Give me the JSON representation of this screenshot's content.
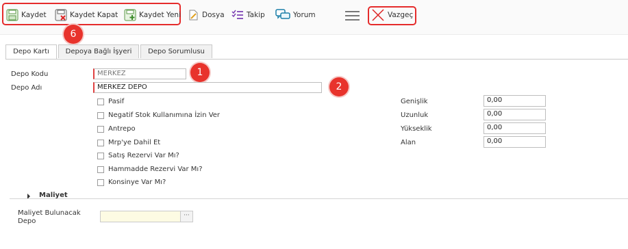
{
  "toolbar": {
    "kaydet": "Kaydet",
    "kaydet_kapat": "Kaydet Kapat",
    "kaydet_yeni": "Kaydet Yeni",
    "dosya": "Dosya",
    "takip": "Takip",
    "yorum": "Yorum",
    "vazgec": "Vazgeç"
  },
  "badges": {
    "b1": "1",
    "b2": "2",
    "b6": "6"
  },
  "tabs": [
    {
      "label": "Depo Kartı",
      "active": true
    },
    {
      "label": "Depoya Bağlı İşyeri",
      "active": false
    },
    {
      "label": "Depo Sorumlusu",
      "active": false
    }
  ],
  "form": {
    "depo_kodu_label": "Depo Kodu",
    "depo_kodu_value": "MERKEZ",
    "depo_adi_label": "Depo Adı",
    "depo_adi_value": "MERKEZ DEPO",
    "checkboxes": [
      "Pasif",
      "Negatif Stok Kullanımına İzin Ver",
      "Antrepo",
      "Mrp'ye Dahil Et",
      "Satış Rezervi Var Mı?",
      "Hammadde Rezervi Var Mı?",
      "Konsinye Var Mı?"
    ],
    "dims": [
      {
        "label": "Genişlik",
        "value": "0,00"
      },
      {
        "label": "Uzunluk",
        "value": "0,00"
      },
      {
        "label": "Yükseklik",
        "value": "0,00"
      },
      {
        "label": "Alan",
        "value": "0,00"
      }
    ]
  },
  "maliyet": {
    "title": "Maliyet",
    "depo_label_line1": "Maliyet Bulunacak",
    "depo_label_line2": "Depo",
    "lookup_button": "···"
  },
  "colors": {
    "highlight": "#e52b2b",
    "badge": "#e8332c",
    "lookup_bg": "#fdfbe3"
  }
}
